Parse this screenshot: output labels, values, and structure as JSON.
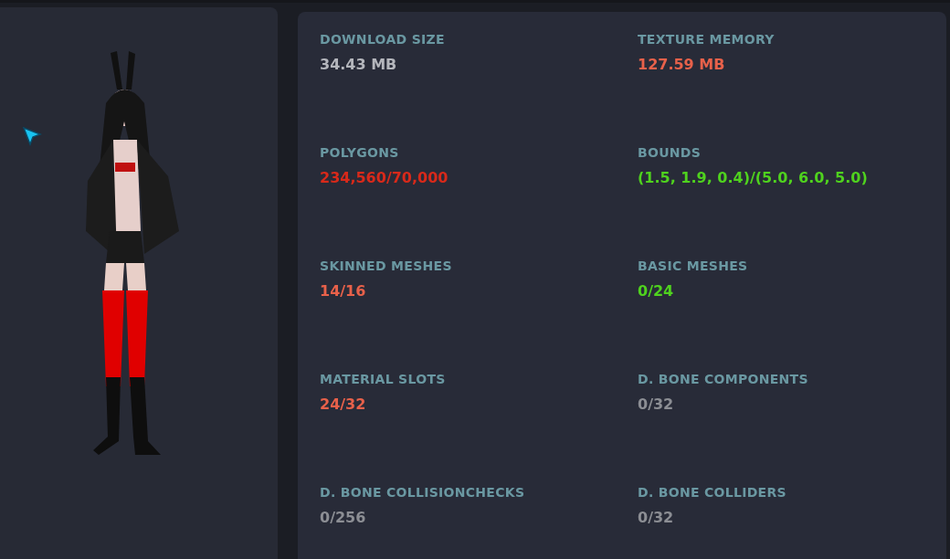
{
  "stats": [
    {
      "label": "DOWNLOAD SIZE",
      "value": "34.43 MB",
      "color": "#b4b6bc"
    },
    {
      "label": "TEXTURE MEMORY",
      "value": "127.59 MB",
      "color": "#e8614a"
    },
    {
      "label": "POLYGONS",
      "value": "234,560/70,000",
      "color": "#d8291a"
    },
    {
      "label": "BOUNDS",
      "value": "(1.5, 1.9, 0.4)/(5.0, 6.0, 5.0)",
      "color": "#4fd21e"
    },
    {
      "label": "SKINNED MESHES",
      "value": "14/16",
      "color": "#e8614a"
    },
    {
      "label": "BASIC MESHES",
      "value": "0/24",
      "color": "#4fd21e"
    },
    {
      "label": "MATERIAL SLOTS",
      "value": "24/32",
      "color": "#e8614a"
    },
    {
      "label": "D. BONE COMPONENTS",
      "value": "0/32",
      "color": "#8c8e94"
    },
    {
      "label": "D. BONE COLLISIONCHECKS",
      "value": "0/256",
      "color": "#8c8e94"
    },
    {
      "label": "D. BONE COLLIDERS",
      "value": "0/32",
      "color": "#8c8e94"
    }
  ]
}
